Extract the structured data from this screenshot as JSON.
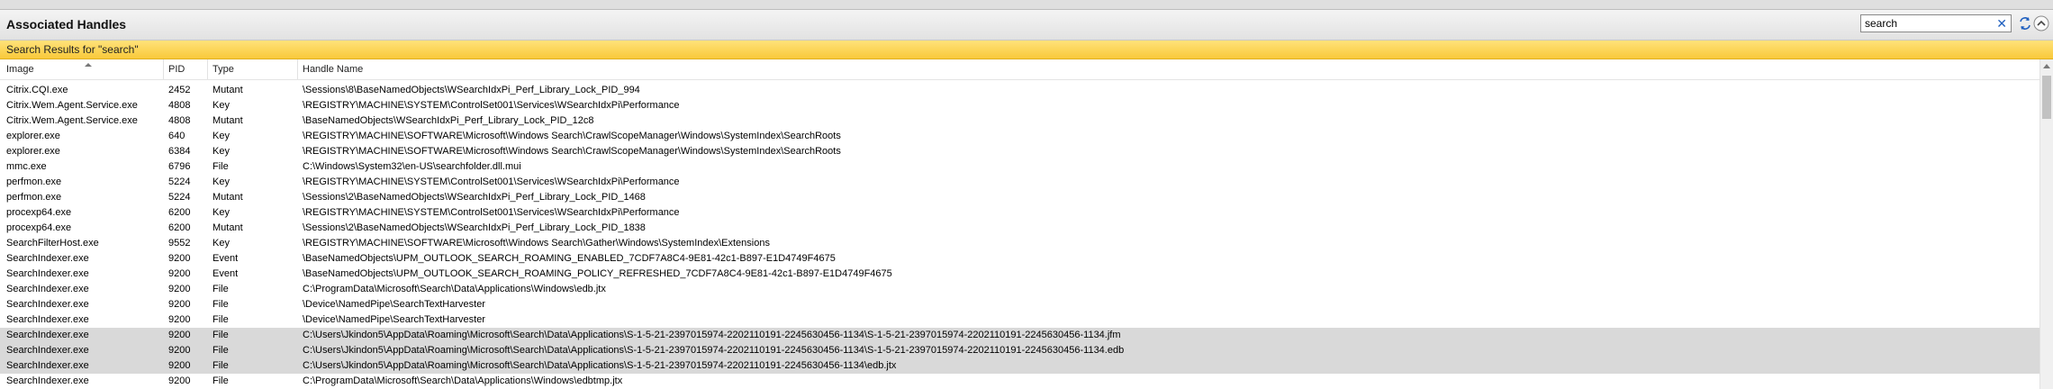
{
  "window": {
    "title": "Associated Handles"
  },
  "search": {
    "value": "search"
  },
  "banner": {
    "text": "Search Results for \"search\""
  },
  "columns": {
    "image": "Image",
    "pid": "PID",
    "type": "Type",
    "name": "Handle Name"
  },
  "rows": [
    {
      "image": "Citrix.CQI.exe",
      "pid": "2452",
      "type": "Mutant",
      "name": "\\Sessions\\8\\BaseNamedObjects\\WSearchIdxPi_Perf_Library_Lock_PID_994"
    },
    {
      "image": "Citrix.Wem.Agent.Service.exe",
      "pid": "4808",
      "type": "Key",
      "name": "\\REGISTRY\\MACHINE\\SYSTEM\\ControlSet001\\Services\\WSearchIdxPi\\Performance"
    },
    {
      "image": "Citrix.Wem.Agent.Service.exe",
      "pid": "4808",
      "type": "Mutant",
      "name": "\\BaseNamedObjects\\WSearchIdxPi_Perf_Library_Lock_PID_12c8"
    },
    {
      "image": "explorer.exe",
      "pid": "640",
      "type": "Key",
      "name": "\\REGISTRY\\MACHINE\\SOFTWARE\\Microsoft\\Windows Search\\CrawlScopeManager\\Windows\\SystemIndex\\SearchRoots"
    },
    {
      "image": "explorer.exe",
      "pid": "6384",
      "type": "Key",
      "name": "\\REGISTRY\\MACHINE\\SOFTWARE\\Microsoft\\Windows Search\\CrawlScopeManager\\Windows\\SystemIndex\\SearchRoots"
    },
    {
      "image": "mmc.exe",
      "pid": "6796",
      "type": "File",
      "name": "C:\\Windows\\System32\\en-US\\searchfolder.dll.mui"
    },
    {
      "image": "perfmon.exe",
      "pid": "5224",
      "type": "Key",
      "name": "\\REGISTRY\\MACHINE\\SYSTEM\\ControlSet001\\Services\\WSearchIdxPi\\Performance"
    },
    {
      "image": "perfmon.exe",
      "pid": "5224",
      "type": "Mutant",
      "name": "\\Sessions\\2\\BaseNamedObjects\\WSearchIdxPi_Perf_Library_Lock_PID_1468"
    },
    {
      "image": "procexp64.exe",
      "pid": "6200",
      "type": "Key",
      "name": "\\REGISTRY\\MACHINE\\SYSTEM\\ControlSet001\\Services\\WSearchIdxPi\\Performance"
    },
    {
      "image": "procexp64.exe",
      "pid": "6200",
      "type": "Mutant",
      "name": "\\Sessions\\2\\BaseNamedObjects\\WSearchIdxPi_Perf_Library_Lock_PID_1838"
    },
    {
      "image": "SearchFilterHost.exe",
      "pid": "9552",
      "type": "Key",
      "name": "\\REGISTRY\\MACHINE\\SOFTWARE\\Microsoft\\Windows Search\\Gather\\Windows\\SystemIndex\\Extensions"
    },
    {
      "image": "SearchIndexer.exe",
      "pid": "9200",
      "type": "Event",
      "name": "\\BaseNamedObjects\\UPM_OUTLOOK_SEARCH_ROAMING_ENABLED_7CDF7A8C4-9E81-42c1-B897-E1D4749F4675"
    },
    {
      "image": "SearchIndexer.exe",
      "pid": "9200",
      "type": "Event",
      "name": "\\BaseNamedObjects\\UPM_OUTLOOK_SEARCH_ROAMING_POLICY_REFRESHED_7CDF7A8C4-9E81-42c1-B897-E1D4749F4675"
    },
    {
      "image": "SearchIndexer.exe",
      "pid": "9200",
      "type": "File",
      "name": "C:\\ProgramData\\Microsoft\\Search\\Data\\Applications\\Windows\\edb.jtx"
    },
    {
      "image": "SearchIndexer.exe",
      "pid": "9200",
      "type": "File",
      "name": "\\Device\\NamedPipe\\SearchTextHarvester"
    },
    {
      "image": "SearchIndexer.exe",
      "pid": "9200",
      "type": "File",
      "name": "\\Device\\NamedPipe\\SearchTextHarvester"
    },
    {
      "image": "SearchIndexer.exe",
      "pid": "9200",
      "type": "File",
      "name": "C:\\Users\\Jkindon5\\AppData\\Roaming\\Microsoft\\Search\\Data\\Applications\\S-1-5-21-2397015974-2202110191-2245630456-1134\\S-1-5-21-2397015974-2202110191-2245630456-1134.jfm",
      "selected": true
    },
    {
      "image": "SearchIndexer.exe",
      "pid": "9200",
      "type": "File",
      "name": "C:\\Users\\Jkindon5\\AppData\\Roaming\\Microsoft\\Search\\Data\\Applications\\S-1-5-21-2397015974-2202110191-2245630456-1134\\S-1-5-21-2397015974-2202110191-2245630456-1134.edb",
      "selected": true
    },
    {
      "image": "SearchIndexer.exe",
      "pid": "9200",
      "type": "File",
      "name": "C:\\Users\\Jkindon5\\AppData\\Roaming\\Microsoft\\Search\\Data\\Applications\\S-1-5-21-2397015974-2202110191-2245630456-1134\\edb.jtx",
      "selected": true
    },
    {
      "image": "SearchIndexer.exe",
      "pid": "9200",
      "type": "File",
      "name": "C:\\ProgramData\\Microsoft\\Search\\Data\\Applications\\Windows\\edbtmp.jtx"
    }
  ],
  "icons": {
    "clear": "clear-search-icon",
    "refresh": "refresh-icon",
    "collapse": "collapse-icon"
  },
  "colors": {
    "banner": "#f9c93a",
    "selected_row": "#d9d9d9",
    "accent": "#1f5fbf"
  }
}
